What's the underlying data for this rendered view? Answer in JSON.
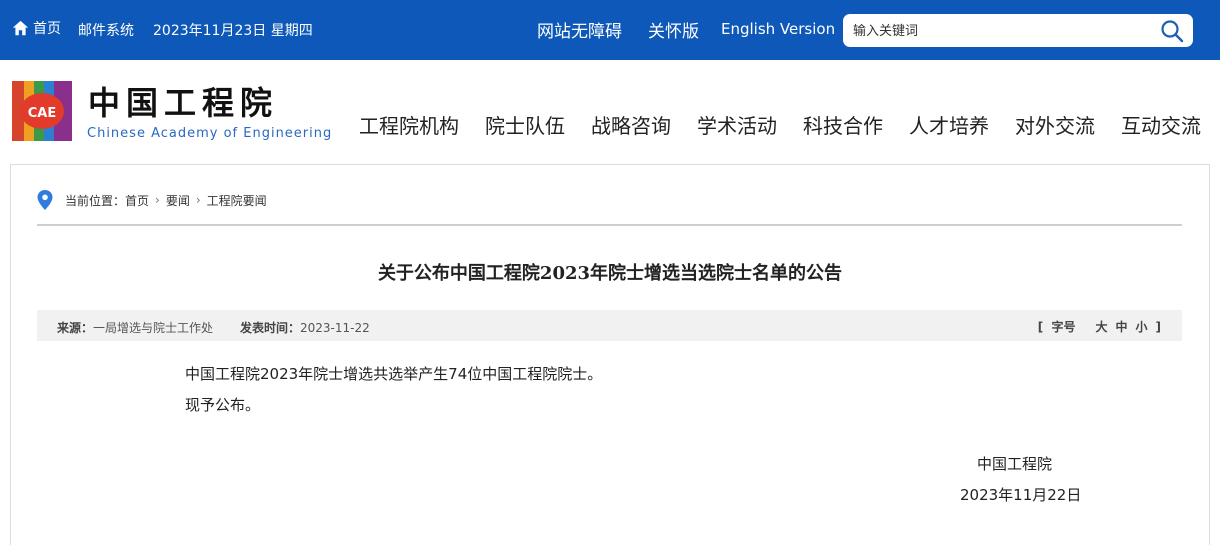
{
  "topbar": {
    "home": "首页",
    "mail": "邮件系统",
    "date": "2023年11月23日  星期四",
    "accessibility": "网站无障碍",
    "care": "关怀版",
    "english": "English Version",
    "search_placeholder": "输入关键词"
  },
  "header": {
    "logo_cn": "中国工程院",
    "logo_en": "Chinese Academy of Engineering",
    "logo_mark": "CAE",
    "nav": [
      "工程院机构",
      "院士队伍",
      "战略咨询",
      "学术活动",
      "科技合作",
      "人才培养",
      "对外交流",
      "互动交流"
    ]
  },
  "breadcrumb": {
    "prefix": "当前位置：",
    "items": [
      "首页",
      "要闻",
      "工程院要闻"
    ]
  },
  "article": {
    "title": "关于公布中国工程院2023年院士增选当选院士名单的公告",
    "source_label": "来源：",
    "source": "一局增选与院士工作处",
    "date_label": "发表时间：",
    "date": "2023-11-22",
    "font_size_label": "字号",
    "sizes": [
      "大",
      "中",
      "小"
    ],
    "paragraphs": [
      "中国工程院2023年院士增选共选举产生74位中国工程院院士。",
      "现予公布。"
    ],
    "signature_org": "中国工程院",
    "signature_date": "2023年11月22日"
  },
  "colors": {
    "topbar": "#0d58b8",
    "link": "#2a68c2"
  }
}
